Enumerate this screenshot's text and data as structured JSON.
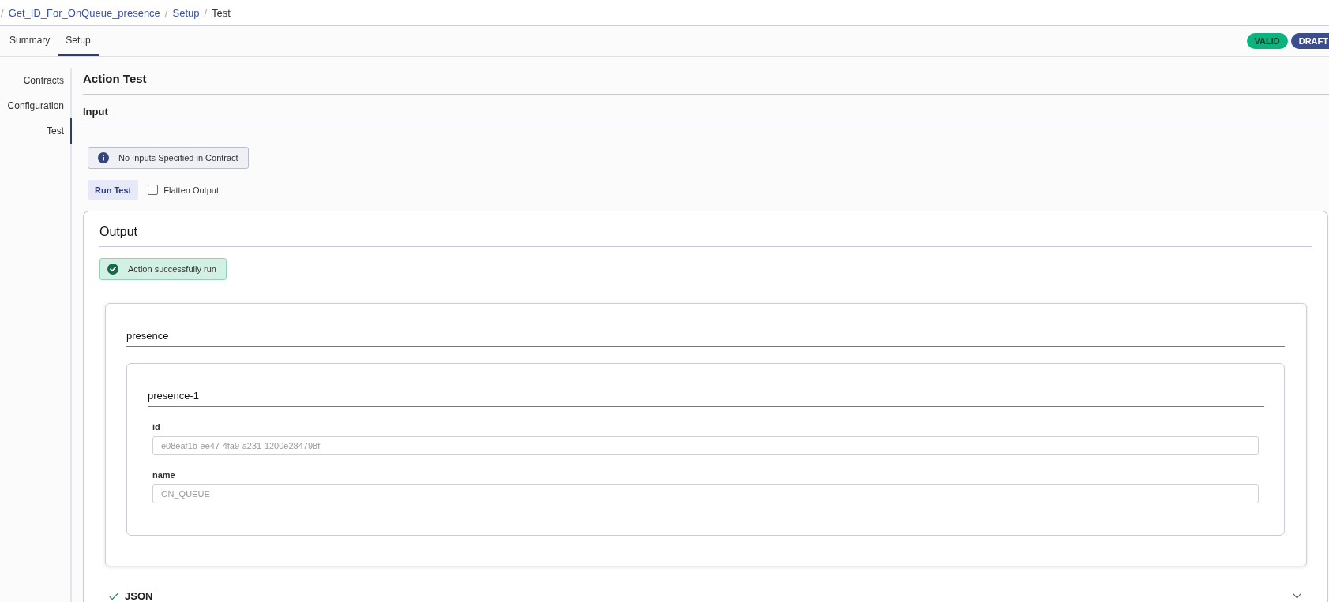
{
  "breadcrumb": {
    "separator": "/",
    "items": [
      {
        "label": "Get_ID_For_OnQueue_presence",
        "kind": "link"
      },
      {
        "label": "Setup",
        "kind": "link"
      },
      {
        "label": "Test",
        "kind": "current"
      }
    ]
  },
  "tabs": [
    {
      "label": "Summary",
      "selected": false
    },
    {
      "label": "Setup",
      "selected": true
    }
  ],
  "status_badges": [
    {
      "label": "VALID",
      "kind": "valid"
    },
    {
      "label": "DRAFT",
      "kind": "draft"
    }
  ],
  "sidebar": {
    "items": [
      {
        "label": "Contracts",
        "selected": false
      },
      {
        "label": "Configuration",
        "selected": false
      },
      {
        "label": "Test",
        "selected": true
      }
    ]
  },
  "title": "Action Test",
  "input": {
    "heading": "Input",
    "notice": "No Inputs Specified in Contract",
    "run_button": "Run Test",
    "flatten_output": {
      "label": "Flatten Output",
      "checked": false
    }
  },
  "output": {
    "heading": "Output",
    "status": "Action successfully run",
    "result": {
      "title": "presence",
      "items": [
        {
          "title": "presence-1",
          "fields": [
            {
              "label": "id",
              "value": "e08eaf1b-ee47-4fa9-a231-1200e284798f",
              "disabled": true
            },
            {
              "label": "name",
              "value": "ON_QUEUE",
              "disabled": true
            }
          ]
        }
      ]
    },
    "json_section": {
      "label": "JSON",
      "expanded": false
    }
  }
}
